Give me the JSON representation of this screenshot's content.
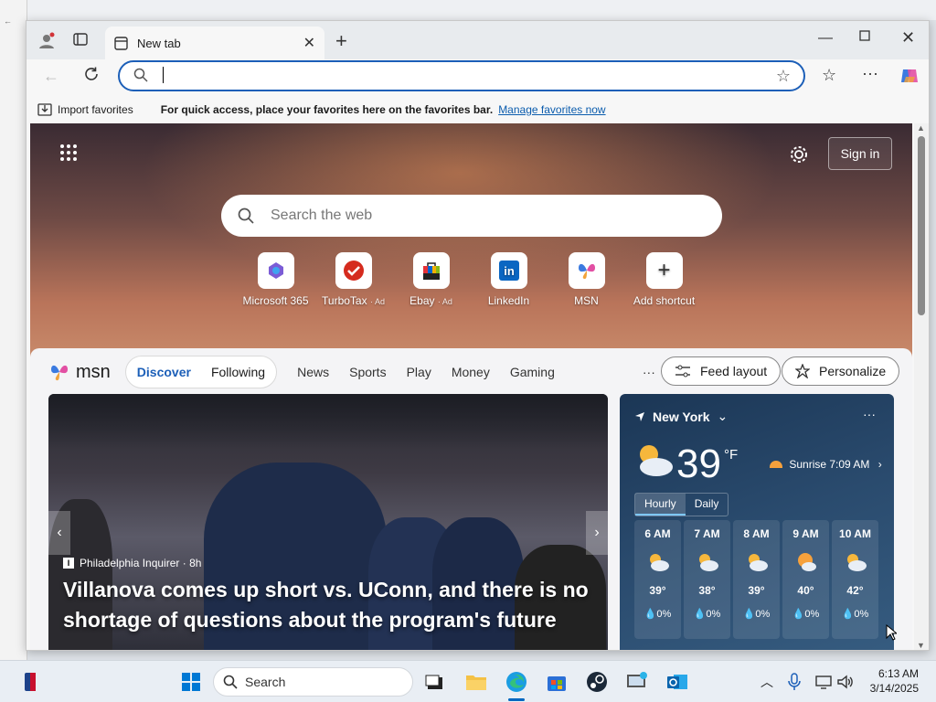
{
  "browser": {
    "tab_title": "New tab",
    "address_value": "",
    "favbar_import": "Import favorites",
    "favbar_message": "For quick access, place your favorites here on the favorites bar.",
    "favbar_link": "Manage favorites now"
  },
  "ntp": {
    "signin": "Sign in",
    "search_placeholder": "Search the web",
    "shortcuts": [
      {
        "label": "Microsoft 365",
        "sub": ""
      },
      {
        "label": "TurboTax",
        "sub": "· Ad"
      },
      {
        "label": "Ebay",
        "sub": "· Ad"
      },
      {
        "label": "LinkedIn",
        "sub": ""
      },
      {
        "label": "MSN",
        "sub": ""
      },
      {
        "label": "Add shortcut",
        "sub": ""
      }
    ]
  },
  "feed": {
    "brand": "msn",
    "tabs": [
      "Discover",
      "Following"
    ],
    "nav": [
      "News",
      "Sports",
      "Play",
      "Money",
      "Gaming"
    ],
    "more": "···",
    "feed_layout": "Feed layout",
    "personalize": "Personalize",
    "hero": {
      "source": "Philadelphia Inquirer · 8h",
      "headline": "Villanova comes up short vs. UConn, and there is no shortage of questions about the program's future"
    }
  },
  "weather": {
    "city": "New York",
    "temp": "39",
    "unit": "°F",
    "sunrise": "Sunrise 7:09 AM",
    "tab_hourly": "Hourly",
    "tab_daily": "Daily",
    "hours": [
      {
        "time": "6 AM",
        "temp": "39°",
        "precip": "0%"
      },
      {
        "time": "7 AM",
        "temp": "38°",
        "precip": "0%"
      },
      {
        "time": "8 AM",
        "temp": "39°",
        "precip": "0%"
      },
      {
        "time": "9 AM",
        "temp": "40°",
        "precip": "0%"
      },
      {
        "time": "10 AM",
        "temp": "42°",
        "precip": "0%"
      }
    ]
  },
  "taskbar": {
    "search_label": "Search",
    "time": "6:13 AM",
    "date": "3/14/2025"
  },
  "colors": {
    "accent": "#1c5fb8",
    "link": "#0b5cad",
    "weather_bg": "#2a4b6e"
  }
}
